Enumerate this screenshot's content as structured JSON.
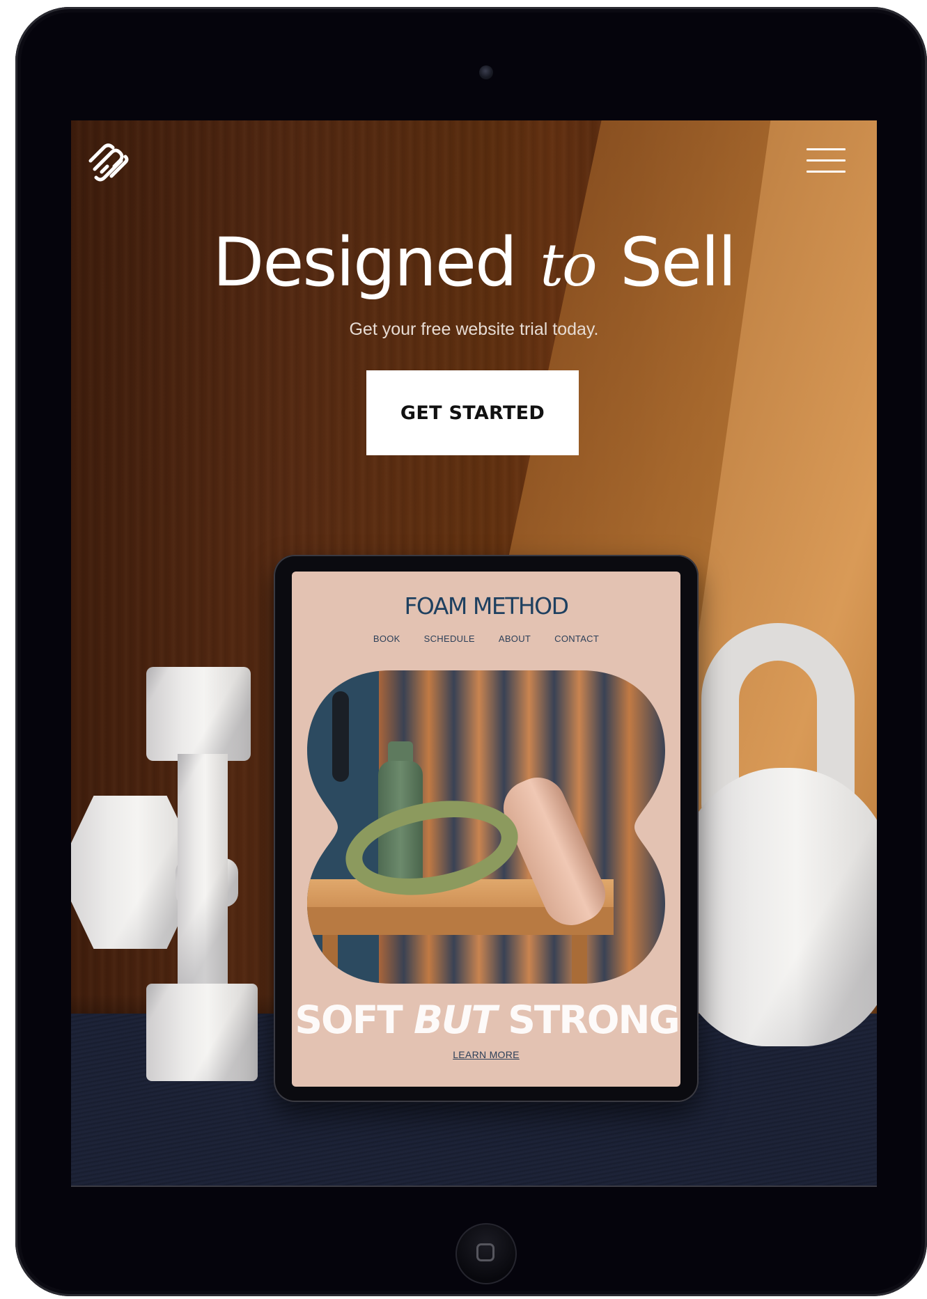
{
  "header": {
    "logo_icon": "squarespace-logo-icon",
    "menu_icon": "hamburger-menu-icon"
  },
  "hero": {
    "title_part1": "Designed",
    "title_italic": "to",
    "title_part2": "Sell",
    "subtitle": "Get your free website trial today.",
    "cta_label": "GET STARTED"
  },
  "mockup": {
    "brand": "FOAM METHOD",
    "nav": [
      "BOOK",
      "SCHEDULE",
      "ABOUT",
      "CONTACT"
    ],
    "tagline_part1": "SOFT",
    "tagline_italic": "BUT",
    "tagline_part2": "STRONG",
    "link_label": "LEARN MORE"
  },
  "device": {
    "camera_icon": "camera-icon",
    "home_icon": "home-button-icon"
  },
  "colors": {
    "brand_blue": "#1e4060",
    "mockup_bg": "#e3c2b2",
    "cta_bg": "#ffffff",
    "device_frame": "#05040c"
  }
}
